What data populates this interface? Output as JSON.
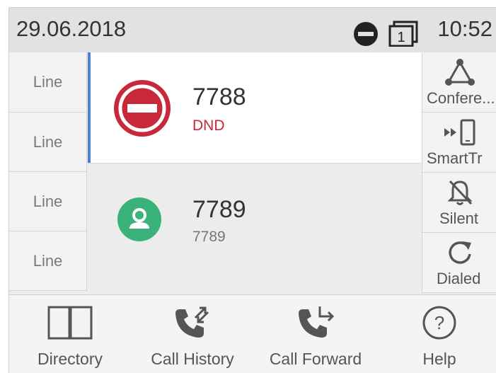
{
  "status_bar": {
    "date": "29.06.2018",
    "time": "10:52",
    "dnd_indicator_icon": "dnd-icon",
    "account_indicator_icon": "account-1-icon",
    "account_number": "1"
  },
  "line_keys": [
    {
      "label": "Line"
    },
    {
      "label": "Line"
    },
    {
      "label": "Line"
    },
    {
      "label": "Line"
    }
  ],
  "accounts": [
    {
      "number": "7788",
      "status": "DND",
      "status_color": "#c8293a",
      "icon": "dnd-icon",
      "selected": true
    },
    {
      "number": "7789",
      "status": "7789",
      "status_color": "#777777",
      "icon": "contact-icon",
      "selected": false
    }
  ],
  "soft_keys": [
    {
      "label": "Confere...",
      "icon": "conference-icon"
    },
    {
      "label": "SmartTr",
      "icon": "smart-transfer-icon"
    },
    {
      "label": "Silent",
      "icon": "silent-icon"
    },
    {
      "label": "Dialed",
      "icon": "redial-icon"
    }
  ],
  "bottom_bar": [
    {
      "label": "Directory",
      "icon": "book-icon"
    },
    {
      "label": "Call History",
      "icon": "call-history-icon"
    },
    {
      "label": "Call Forward",
      "icon": "call-forward-icon"
    },
    {
      "label": "Help",
      "icon": "help-icon"
    }
  ],
  "colors": {
    "dnd_red": "#c8293a",
    "online_green": "#3bb27a",
    "selection_blue": "#4a86c5"
  }
}
